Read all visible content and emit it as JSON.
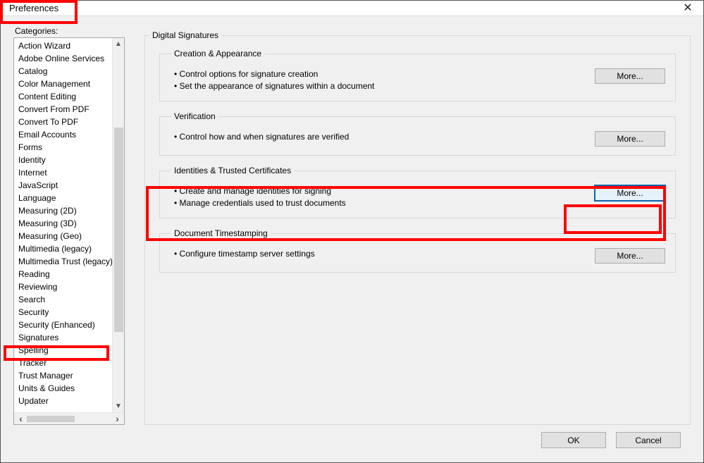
{
  "window": {
    "title": "Preferences"
  },
  "categories_label": "Categories:",
  "categories": [
    "Action Wizard",
    "Adobe Online Services",
    "Catalog",
    "Color Management",
    "Content Editing",
    "Convert From PDF",
    "Convert To PDF",
    "Email Accounts",
    "Forms",
    "Identity",
    "Internet",
    "JavaScript",
    "Language",
    "Measuring (2D)",
    "Measuring (3D)",
    "Measuring (Geo)",
    "Multimedia (legacy)",
    "Multimedia Trust (legacy)",
    "Reading",
    "Reviewing",
    "Search",
    "Security",
    "Security (Enhanced)",
    "Signatures",
    "Spelling",
    "Tracker",
    "Trust Manager",
    "Units & Guides",
    "Updater"
  ],
  "panel": {
    "title": "Digital Signatures",
    "sections": [
      {
        "title": "Creation & Appearance",
        "bullets": [
          "Control options for signature creation",
          "Set the appearance of signatures within a document"
        ],
        "button": "More..."
      },
      {
        "title": "Verification",
        "bullets": [
          "Control how and when signatures are verified"
        ],
        "button": "More..."
      },
      {
        "title": "Identities & Trusted Certificates",
        "bullets": [
          "Create and manage identities for signing",
          "Manage credentials used to trust documents"
        ],
        "button": "More..."
      },
      {
        "title": "Document Timestamping",
        "bullets": [
          "Configure timestamp server settings"
        ],
        "button": "More..."
      }
    ]
  },
  "footer": {
    "ok": "OK",
    "cancel": "Cancel"
  }
}
